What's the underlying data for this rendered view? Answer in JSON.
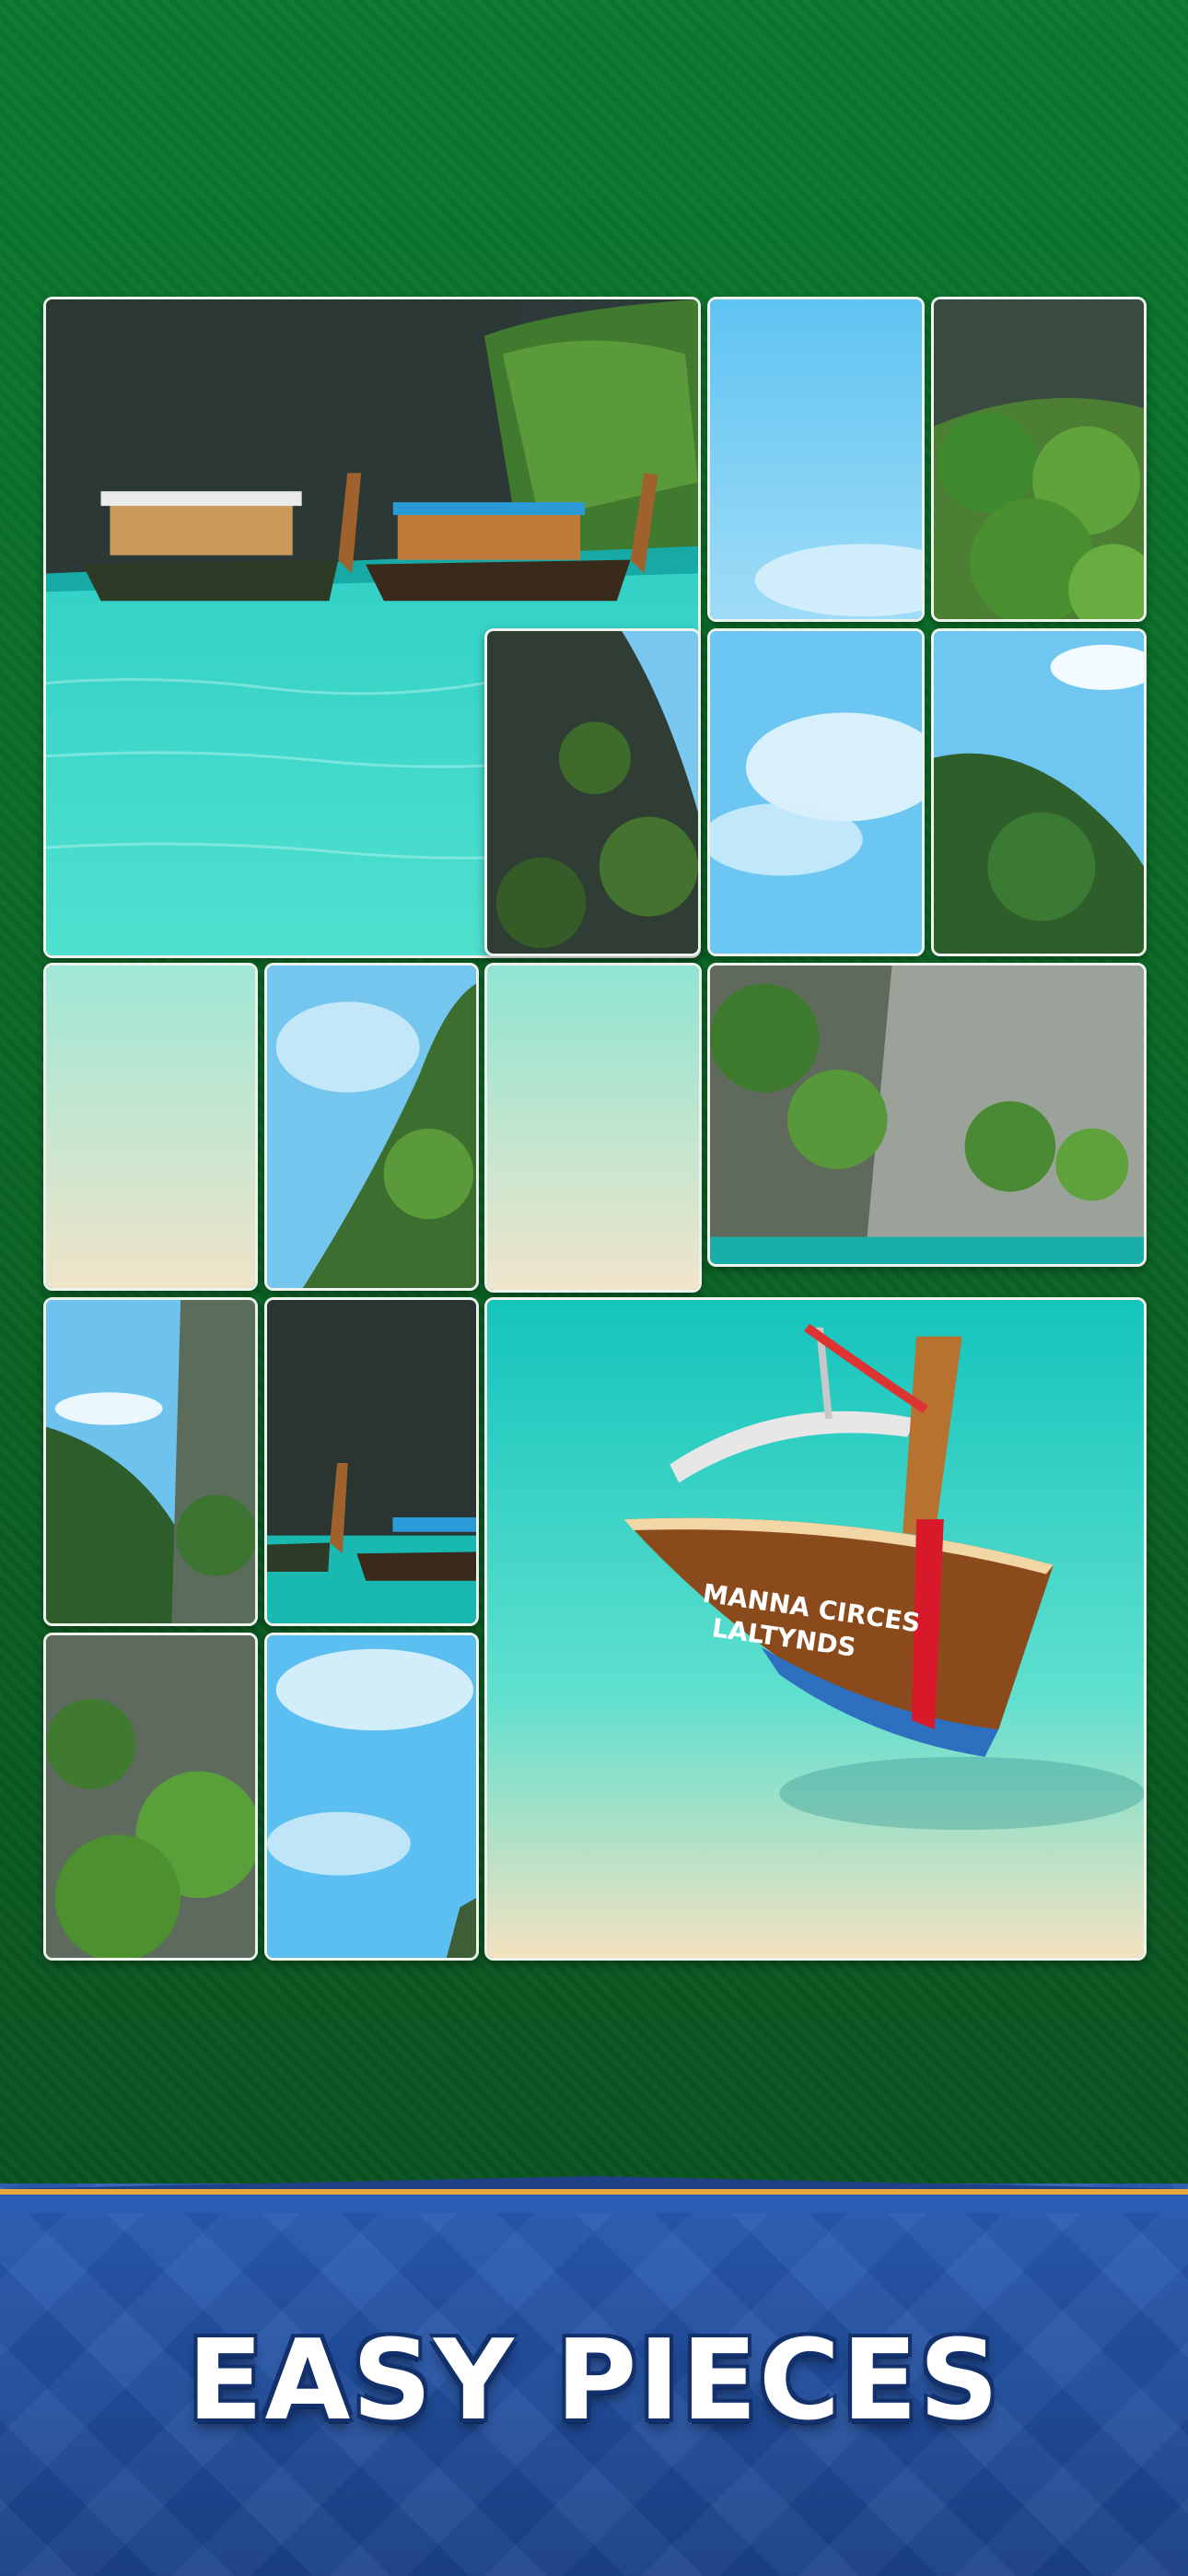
{
  "banner": {
    "title": "EASY PIECES"
  },
  "puzzle": {
    "pieces": [
      {
        "id": "piece-large-boats-cliffs",
        "scene": "boats-cliffs-lagoon"
      },
      {
        "id": "piece-sky-top",
        "scene": "sky"
      },
      {
        "id": "piece-cliff-top-right",
        "scene": "cliff-green"
      },
      {
        "id": "piece-cliff-dark",
        "scene": "cliff-dark"
      },
      {
        "id": "piece-sky-clouds",
        "scene": "sky-clouds"
      },
      {
        "id": "piece-sky-hill",
        "scene": "sky-hill"
      },
      {
        "id": "piece-shallow-water-1",
        "scene": "shallow-water"
      },
      {
        "id": "piece-sky-cliff-slope",
        "scene": "sky-cliff"
      },
      {
        "id": "piece-shallow-water-2",
        "scene": "shallow-water"
      },
      {
        "id": "piece-cliff-wide",
        "scene": "cliff-wide"
      },
      {
        "id": "piece-sky-hills-left",
        "scene": "sky-hills"
      },
      {
        "id": "piece-boats-small",
        "scene": "boats-small"
      },
      {
        "id": "piece-large-boat-beach",
        "scene": "boat-beach"
      },
      {
        "id": "piece-cliff-green-bottom",
        "scene": "cliff-green"
      },
      {
        "id": "piece-sky-bottom",
        "scene": "sky-clouds"
      }
    ]
  },
  "boat_text": {
    "line1": "MANNA CIRCES",
    "line2": "LALTYNDS"
  },
  "colors": {
    "felt": "#0a6a27",
    "banner": "#214f9f",
    "trim": "#e2a63a",
    "tile_border": "#eef3ee"
  }
}
